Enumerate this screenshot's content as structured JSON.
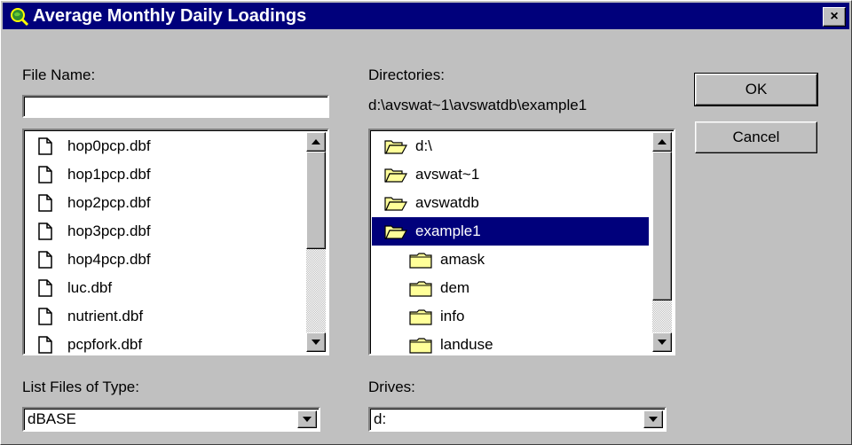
{
  "window": {
    "title": "Average Monthly Daily Loadings",
    "close_label": "×"
  },
  "file_name": {
    "label": "File Name:",
    "value": ""
  },
  "files": [
    "hop0pcp.dbf",
    "hop1pcp.dbf",
    "hop2pcp.dbf",
    "hop3pcp.dbf",
    "hop4pcp.dbf",
    "luc.dbf",
    "nutrient.dbf",
    "pcpfork.dbf"
  ],
  "directories": {
    "label": "Directories:",
    "path": "d:\\avswat~1\\avswatdb\\example1",
    "items": [
      {
        "name": "d:\\",
        "open": true,
        "selected": false
      },
      {
        "name": "avswat~1",
        "open": true,
        "selected": false
      },
      {
        "name": "avswatdb",
        "open": true,
        "selected": false
      },
      {
        "name": "example1",
        "open": true,
        "selected": true
      },
      {
        "name": "amask",
        "open": false,
        "selected": false
      },
      {
        "name": "dem",
        "open": false,
        "selected": false
      },
      {
        "name": "info",
        "open": false,
        "selected": false
      },
      {
        "name": "landuse",
        "open": false,
        "selected": false
      }
    ]
  },
  "buttons": {
    "ok": "OK",
    "cancel": "Cancel"
  },
  "file_type": {
    "label": "List Files of Type:",
    "value": "dBASE"
  },
  "drives": {
    "label": "Drives:",
    "value": "d:"
  },
  "colors": {
    "titlebar": "#00007b",
    "face": "#c0c0c0",
    "folder": "#ffff99"
  }
}
